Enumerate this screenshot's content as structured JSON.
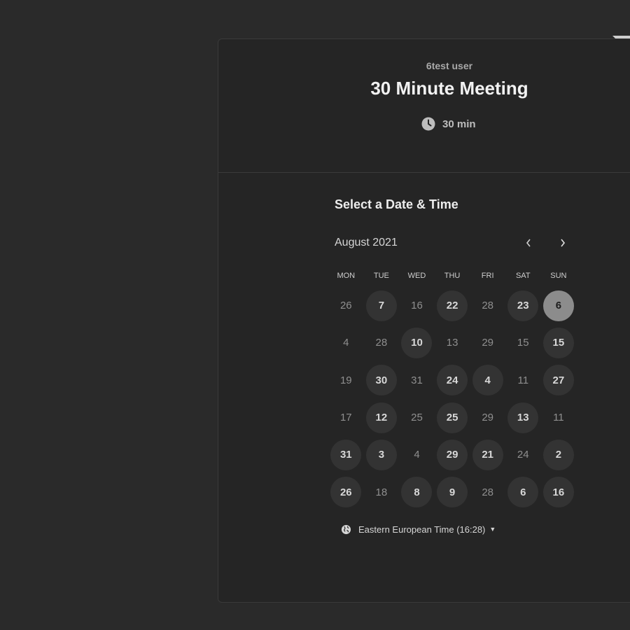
{
  "event": {
    "organizer": "6test user",
    "title": "30 Minute Meeting",
    "duration": "30 min"
  },
  "calendar": {
    "section_title": "Select a Date & Time",
    "month": "August 2021",
    "weekdays": [
      "MON",
      "TUE",
      "WED",
      "THU",
      "FRI",
      "SAT",
      "SUN"
    ],
    "days": [
      {
        "label": "26",
        "state": "unavailable"
      },
      {
        "label": "7",
        "state": "available"
      },
      {
        "label": "16",
        "state": "unavailable"
      },
      {
        "label": "22",
        "state": "available"
      },
      {
        "label": "28",
        "state": "unavailable"
      },
      {
        "label": "23",
        "state": "available"
      },
      {
        "label": "6",
        "state": "selected"
      },
      {
        "label": "4",
        "state": "unavailable"
      },
      {
        "label": "28",
        "state": "unavailable"
      },
      {
        "label": "10",
        "state": "available"
      },
      {
        "label": "13",
        "state": "unavailable"
      },
      {
        "label": "29",
        "state": "unavailable"
      },
      {
        "label": "15",
        "state": "unavailable"
      },
      {
        "label": "15",
        "state": "available"
      },
      {
        "label": "19",
        "state": "unavailable"
      },
      {
        "label": "30",
        "state": "available"
      },
      {
        "label": "31",
        "state": "unavailable"
      },
      {
        "label": "24",
        "state": "available"
      },
      {
        "label": "4",
        "state": "available"
      },
      {
        "label": "11",
        "state": "unavailable"
      },
      {
        "label": "27",
        "state": "available"
      },
      {
        "label": "17",
        "state": "unavailable"
      },
      {
        "label": "12",
        "state": "available"
      },
      {
        "label": "25",
        "state": "unavailable"
      },
      {
        "label": "25",
        "state": "available"
      },
      {
        "label": "29",
        "state": "unavailable"
      },
      {
        "label": "13",
        "state": "available"
      },
      {
        "label": "11",
        "state": "unavailable"
      },
      {
        "label": "31",
        "state": "available"
      },
      {
        "label": "3",
        "state": "available"
      },
      {
        "label": "4",
        "state": "unavailable"
      },
      {
        "label": "29",
        "state": "available"
      },
      {
        "label": "21",
        "state": "available"
      },
      {
        "label": "24",
        "state": "unavailable"
      },
      {
        "label": "2",
        "state": "available"
      },
      {
        "label": "26",
        "state": "available"
      },
      {
        "label": "18",
        "state": "unavailable"
      },
      {
        "label": "8",
        "state": "available"
      },
      {
        "label": "9",
        "state": "available"
      },
      {
        "label": "28",
        "state": "unavailable"
      },
      {
        "label": "6",
        "state": "available"
      },
      {
        "label": "16",
        "state": "available"
      }
    ]
  },
  "timezone": {
    "label": "Eastern European Time (16:28)"
  },
  "icons": {
    "clock": "clock-icon",
    "prev": "chevron-left-icon",
    "next": "chevron-right-icon",
    "globe": "globe-icon",
    "caret": "caret-down-icon"
  },
  "colors": {
    "background": "#2a2a2a",
    "card": "#252525",
    "available_day": "#333333",
    "selected_day": "#8c8c8c"
  }
}
